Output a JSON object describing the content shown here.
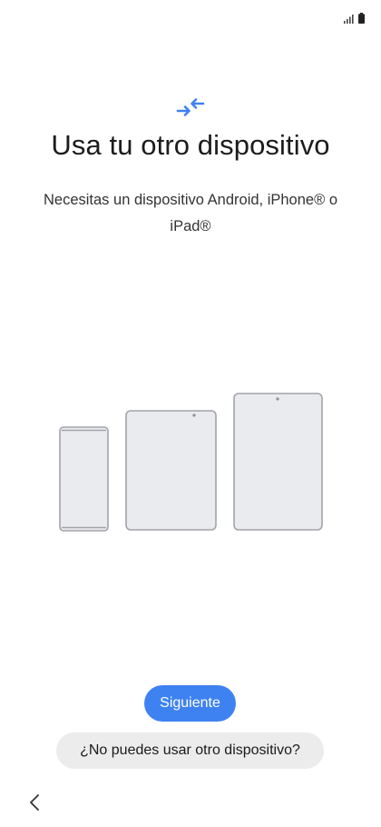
{
  "status_bar": {
    "icons": [
      "signal-icon",
      "battery-icon"
    ]
  },
  "header": {
    "icon": "transfer-arrows-icon",
    "accent_color": "#3e82f1",
    "title": "Usa tu otro dispositivo",
    "subtitle": "Necesitas un dispositivo Android, iPhone® o iPad®"
  },
  "illustration": {
    "icon": "devices-illustration",
    "devices": [
      "phone",
      "small-tablet",
      "large-tablet"
    ]
  },
  "actions": {
    "primary_label": "Siguiente",
    "primary_color": "#3e82f1",
    "secondary_label": "¿No puedes usar otro dispositivo?"
  },
  "navigation": {
    "back_icon": "chevron-left-icon"
  }
}
